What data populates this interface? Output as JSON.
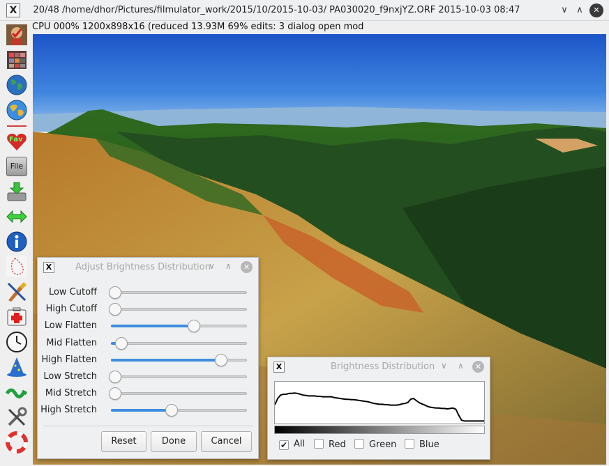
{
  "window": {
    "title": "20/48 /home/dhor/Pictures/filmulator_work/2015/10/2015-10-03/ PA030020_f9nxjYZ.ORF 2015-10-03 08:47",
    "app_icon": "X",
    "controls": {
      "minimize": "∨",
      "maximize": "∧",
      "close": "✕"
    }
  },
  "status": "CPU 000%  1200x898x16 (reduced  13.93M  69%  edits: 3  dialog open  mod",
  "sidebar": {
    "file_label": "File",
    "fav_label": "Fav",
    "items": [
      "portrait-icon",
      "filmstrip-icon",
      "globe-icon",
      "globe-2-icon",
      "fav-icon",
      "file-icon",
      "save-icon",
      "arrows-icon",
      "info-icon",
      "lasso-icon",
      "paint-icon",
      "first-aid-icon",
      "clock-icon",
      "wizard-icon",
      "wave-icon",
      "tools-icon",
      "lifebuoy-icon"
    ]
  },
  "adjust_dialog": {
    "title": "Adjust Brightness Distribution",
    "sliders": [
      {
        "label": "Low Cutoff",
        "value": 0.0
      },
      {
        "label": "High Cutoff",
        "value": 0.0
      },
      {
        "label": "Low Flatten",
        "value": 0.64
      },
      {
        "label": "Mid Flatten",
        "value": 0.05
      },
      {
        "label": "High Flatten",
        "value": 0.86
      },
      {
        "label": "Low Stretch",
        "value": 0.0
      },
      {
        "label": "Mid Stretch",
        "value": 0.0
      },
      {
        "label": "High Stretch",
        "value": 0.46
      }
    ],
    "buttons": {
      "reset": "Reset",
      "done": "Done",
      "cancel": "Cancel"
    }
  },
  "histogram_dialog": {
    "title": "Brightness Distribution",
    "checkboxes": [
      {
        "label": "All",
        "checked": true
      },
      {
        "label": "Red",
        "checked": false
      },
      {
        "label": "Green",
        "checked": false
      },
      {
        "label": "Blue",
        "checked": false
      }
    ],
    "histogram": [
      0.45,
      0.6,
      0.68,
      0.7,
      0.7,
      0.72,
      0.72,
      0.73,
      0.72,
      0.7,
      0.68,
      0.67,
      0.66,
      0.66,
      0.66,
      0.65,
      0.65,
      0.64,
      0.64,
      0.64,
      0.64,
      0.62,
      0.61,
      0.6,
      0.59,
      0.58,
      0.58,
      0.57,
      0.57,
      0.56,
      0.55,
      0.54,
      0.53,
      0.52,
      0.5,
      0.48,
      0.47,
      0.46,
      0.46,
      0.45,
      0.45,
      0.44,
      0.44,
      0.44,
      0.45,
      0.47,
      0.48,
      0.5,
      0.58,
      0.6,
      0.55,
      0.5,
      0.47,
      0.44,
      0.41,
      0.39,
      0.38,
      0.37,
      0.37,
      0.36,
      0.36,
      0.35,
      0.36,
      0.37,
      0.34,
      0.2,
      0.08,
      0.06,
      0.06,
      0.06,
      0.06,
      0.06,
      0.06,
      0.06,
      0.06
    ]
  }
}
